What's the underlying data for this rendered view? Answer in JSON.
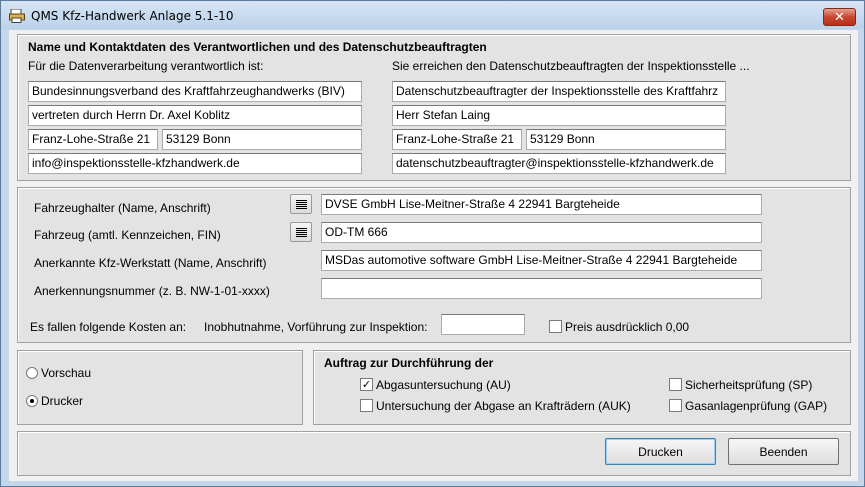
{
  "window": {
    "title": "QMS Kfz-Handwerk Anlage 5.1-10",
    "close_label": "✕"
  },
  "contact": {
    "heading": "Name und Kontaktdaten des Verantwortlichen und des Datenschutzbeauftragten",
    "left_label": "Für die Datenverarbeitung verantwortlich ist:",
    "right_label": "Sie erreichen den Datenschutzbeauftragten der Inspektionsstelle ...",
    "left": {
      "name": "Bundesinnungsverband des Kraftfahrzeughandwerks (BIV)",
      "represented": "vertreten durch Herrn Dr. Axel Koblitz",
      "street": "Franz-Lohe-Straße 21",
      "city": "53129 Bonn",
      "email": "info@inspektionsstelle-kfzhandwerk.de"
    },
    "right": {
      "name": "Datenschutzbeauftragter der Inspektionsstelle des Kraftfahrz",
      "person": "Herr Stefan Laing",
      "street": "Franz-Lohe-Straße 21",
      "city": "53129 Bonn",
      "email": "datenschutzbeauftragter@inspektionsstelle-kfzhandwerk.de"
    }
  },
  "vehicle": {
    "owner_label": "Fahrzeughalter (Name, Anschrift)",
    "owner_value": "DVSE GmbH  Lise-Meitner-Straße 4  22941 Bargteheide",
    "vehicle_label": "Fahrzeug (amtl. Kennzeichen, FIN)",
    "vehicle_value": "OD-TM 666",
    "workshop_label": "Anerkannte Kfz-Werkstatt (Name, Anschrift)",
    "workshop_value": "MSDas automotive software GmbH  Lise-Meitner-Straße 4  22941 Bargteheide",
    "recognition_label": "Anerkennungsnummer (z. B. NW-1-01-xxxx)",
    "recognition_value": "",
    "costs_label": "Es fallen folgende Kosten an:",
    "costs_desc": "Inobhutnahme, Vorführung zur Inspektion:",
    "costs_value": "",
    "price_label": "Preis ausdrücklich 0,00"
  },
  "output": {
    "preview_label": "Vorschau",
    "printer_label": "Drucker"
  },
  "order": {
    "heading": "Auftrag zur Durchführung der",
    "au_label": "Abgasuntersuchung (AU)",
    "auk_label": "Untersuchung der Abgase an Krafträdern (AUK)",
    "sp_label": "Sicherheitsprüfung (SP)",
    "gap_label": "Gasanlagenprüfung (GAP)",
    "checkmark": "✓"
  },
  "buttons": {
    "print_label": "Drucken",
    "exit_label": "Beenden"
  }
}
